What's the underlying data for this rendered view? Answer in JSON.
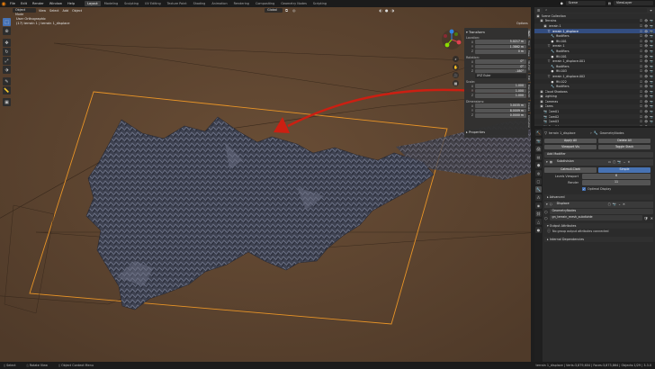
{
  "app": {
    "menus": [
      "File",
      "Edit",
      "Render",
      "Window",
      "Help"
    ],
    "workspaces": [
      "Layout",
      "Modeling",
      "Sculpting",
      "UV Editing",
      "Texture Paint",
      "Shading",
      "Animation",
      "Rendering",
      "Compositing",
      "Geometry Nodes",
      "Scripting"
    ],
    "active_workspace": "Layout",
    "scene": "Scene",
    "view_layer": "ViewLayer"
  },
  "viewport": {
    "mode": "Object Mode",
    "menus": [
      "View",
      "Select",
      "Add",
      "Object"
    ],
    "transform_orientation": "Global",
    "info_line1": "User Orthographic",
    "info_line2": "(17) terrain 1 | terrain 1_displace",
    "options_label": "Options"
  },
  "npanel": {
    "tabs": [
      "Item",
      "Tool",
      "View",
      "3D-Print",
      "Edit",
      "BlenderKit",
      "Create",
      "Animation"
    ],
    "active_tab": "Item",
    "transform_title": "Transform",
    "location_label": "Location:",
    "location": [
      {
        "axis": "X",
        "value": "5.0217 m"
      },
      {
        "axis": "Y",
        "value": "1.3862 m"
      },
      {
        "axis": "Z",
        "value": "0 m"
      }
    ],
    "rotation_label": "Rotation:",
    "rotation": [
      {
        "axis": "X",
        "value": "0°"
      },
      {
        "axis": "Y",
        "value": "0°"
      },
      {
        "axis": "Z",
        "value": "-180°"
      }
    ],
    "rotation_mode": "XYZ Euler",
    "scale_label": "Scale:",
    "scale": [
      {
        "axis": "X",
        "value": "1.000"
      },
      {
        "axis": "Y",
        "value": "1.000"
      },
      {
        "axis": "Z",
        "value": "1.000"
      }
    ],
    "dimensions_label": "Dimensions:",
    "dimensions": [
      {
        "axis": "X",
        "value": "3.0035 m"
      },
      {
        "axis": "Y",
        "value": "8.0009 m"
      },
      {
        "axis": "Z",
        "value": "0.0000 m"
      }
    ],
    "properties_label": "Properties"
  },
  "outliner": {
    "title": "Scene Collection",
    "rows": [
      {
        "indent": 1,
        "icon": "▣",
        "name": "Terrains"
      },
      {
        "indent": 2,
        "icon": "▣",
        "name": "terrain 1"
      },
      {
        "indent": 3,
        "icon": "▽",
        "name": "terrain 1_displace"
      },
      {
        "indent": 4,
        "icon": "🔧",
        "name": "Modifiers"
      },
      {
        "indent": 4,
        "icon": "●",
        "name": "Mtl.001"
      },
      {
        "indent": 3,
        "icon": "▽",
        "name": "terrain 1"
      },
      {
        "indent": 4,
        "icon": "🔧",
        "name": "Modifiers"
      },
      {
        "indent": 4,
        "icon": "●",
        "name": "Mtl.001"
      },
      {
        "indent": 3,
        "icon": "▽",
        "name": "terrain 1_displace.001"
      },
      {
        "indent": 4,
        "icon": "🔧",
        "name": "Modifiers"
      },
      {
        "indent": 4,
        "icon": "●",
        "name": "Mtl.003"
      },
      {
        "indent": 3,
        "icon": "▽",
        "name": "terrain 1_displace.002"
      },
      {
        "indent": 4,
        "icon": "●",
        "name": "Mtl.022"
      },
      {
        "indent": 4,
        "icon": "🔧",
        "name": "Modifiers"
      },
      {
        "indent": 1,
        "icon": "▣",
        "name": "Cloud Shadows"
      },
      {
        "indent": 1,
        "icon": "▣",
        "name": "Lighting"
      },
      {
        "indent": 1,
        "icon": "▣",
        "name": "Cameras"
      },
      {
        "indent": 1,
        "icon": "▣",
        "name": "Cams"
      },
      {
        "indent": 2,
        "icon": "📷",
        "name": "Cam01"
      },
      {
        "indent": 2,
        "icon": "📷",
        "name": "Cam02"
      },
      {
        "indent": 2,
        "icon": "📷",
        "name": "Cam03"
      },
      {
        "indent": 2,
        "icon": "📷",
        "name": "Cam04"
      }
    ],
    "selected_index": 2
  },
  "properties": {
    "object_name": "terrain 1_displace",
    "modifier_type": "GeometryNodes",
    "apply_label": "Apply All",
    "delete_label": "Delete All",
    "viewport_label": "Viewport Vis",
    "toggle_stack_label": "Toggle Stack",
    "add_modifier_label": "Add Modifier",
    "modifier_name": "Subdivision",
    "subdiv_buttons": [
      "Catmull-Clark",
      "Simple"
    ],
    "levels_viewport_label": "Levels Viewport",
    "levels_viewport_value": "6",
    "render_label": "Render",
    "render_value": "11",
    "optimal_display_label": "Optimal Display",
    "advanced_label": "Advanced",
    "gn_modifier_name": "Displace",
    "gn_nodes_name": "GeometryNodes",
    "node_group": "gn_terrain_mesh_subdivide",
    "output_attributes_label": "Output Attributes",
    "no_output_label": "No group output attributes connected",
    "internal_deps_label": "Internal Dependencies"
  },
  "status": {
    "left": "Select",
    "mid1": "Rotate View",
    "mid2": "Object Context Menu",
    "stats": "terrain 1_displace | Verts:3,879,604 | Faces:3,873,864 | Objects:1/29 | 3.3.0"
  },
  "colors": {
    "viewport_bg": "#5a4330",
    "accent": "#4772b3",
    "selection_outline": "#e89427",
    "arrow": "#cc1f12",
    "blender_orange": "#e87d0d"
  }
}
